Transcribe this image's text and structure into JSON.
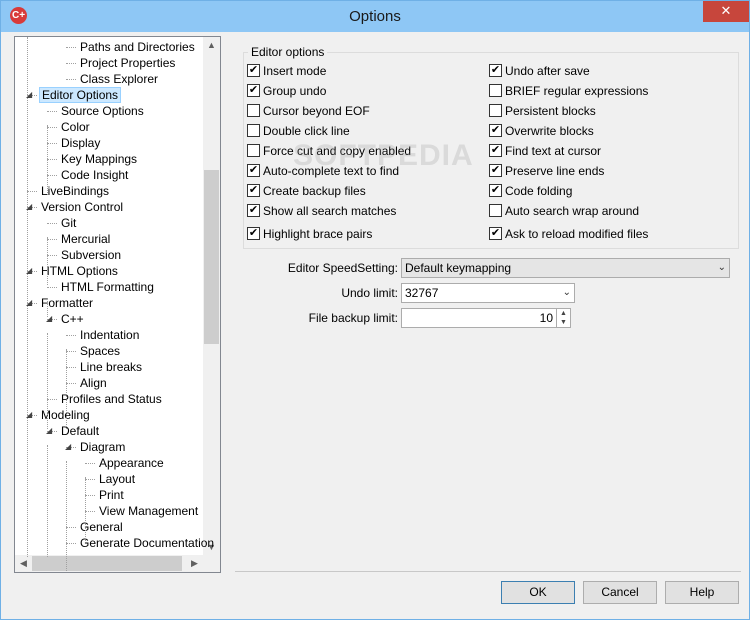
{
  "window": {
    "title": "Options",
    "close_glyph": "✕",
    "app_icon_text": "C+"
  },
  "tree": {
    "items": [
      {
        "label": "Paths and Directories",
        "expander": ""
      },
      {
        "label": "Project Properties",
        "expander": ""
      },
      {
        "label": "Class Explorer",
        "expander": ""
      },
      {
        "label": "Editor Options",
        "expander": "◢"
      },
      {
        "label": "Source Options",
        "expander": ""
      },
      {
        "label": "Color",
        "expander": ""
      },
      {
        "label": "Display",
        "expander": ""
      },
      {
        "label": "Key Mappings",
        "expander": ""
      },
      {
        "label": "Code Insight",
        "expander": ""
      },
      {
        "label": "LiveBindings",
        "expander": ""
      },
      {
        "label": "Version Control",
        "expander": "◢"
      },
      {
        "label": "Git",
        "expander": ""
      },
      {
        "label": "Mercurial",
        "expander": ""
      },
      {
        "label": "Subversion",
        "expander": ""
      },
      {
        "label": "HTML Options",
        "expander": "◢"
      },
      {
        "label": "HTML Formatting",
        "expander": ""
      },
      {
        "label": "Formatter",
        "expander": "◢"
      },
      {
        "label": "C++",
        "expander": "◢"
      },
      {
        "label": "Indentation",
        "expander": ""
      },
      {
        "label": "Spaces",
        "expander": ""
      },
      {
        "label": "Line breaks",
        "expander": ""
      },
      {
        "label": "Align",
        "expander": ""
      },
      {
        "label": "Profiles and Status",
        "expander": ""
      },
      {
        "label": "Modeling",
        "expander": "◢"
      },
      {
        "label": "Default",
        "expander": "◢"
      },
      {
        "label": "Diagram",
        "expander": "◢"
      },
      {
        "label": "Appearance",
        "expander": ""
      },
      {
        "label": "Layout",
        "expander": ""
      },
      {
        "label": "Print",
        "expander": ""
      },
      {
        "label": "View Management",
        "expander": ""
      },
      {
        "label": "General",
        "expander": ""
      },
      {
        "label": "Generate Documentation",
        "expander": ""
      }
    ],
    "selected": "Editor Options",
    "scroll_up": "▲",
    "scroll_down": "▼",
    "scroll_left": "◀",
    "scroll_right": "▶"
  },
  "editor_options": {
    "legend": "Editor options",
    "left": [
      {
        "label": "Insert mode",
        "checked": true
      },
      {
        "label": "Group undo",
        "checked": true
      },
      {
        "label": "Cursor beyond EOF",
        "checked": false
      },
      {
        "label": "Double click line",
        "checked": false
      },
      {
        "label": "Force cut and copy enabled",
        "checked": false
      },
      {
        "label": "Auto-complete text to find",
        "checked": true
      },
      {
        "label": "Create backup files",
        "checked": true
      },
      {
        "label": "Show all search matches",
        "checked": true
      },
      {
        "label": "Highlight brace pairs",
        "checked": true
      }
    ],
    "right": [
      {
        "label": "Undo after save",
        "checked": true
      },
      {
        "label": "BRIEF regular expressions",
        "checked": false
      },
      {
        "label": "Persistent blocks",
        "checked": false
      },
      {
        "label": "Overwrite blocks",
        "checked": true
      },
      {
        "label": "Find text at cursor",
        "checked": true
      },
      {
        "label": "Preserve line ends",
        "checked": true
      },
      {
        "label": "Code folding",
        "checked": true
      },
      {
        "label": "Auto search wrap around",
        "checked": false
      },
      {
        "label": "Ask to reload modified files",
        "checked": true
      }
    ],
    "check_glyph": "✔"
  },
  "fields": {
    "speed_label": "Editor SpeedSetting:",
    "speed_value": "Default keymapping",
    "undo_label": "Undo limit:",
    "undo_value": "32767",
    "backup_label": "File backup limit:",
    "backup_value": "10",
    "dropdown_glyph": "⌄"
  },
  "watermark": "SOFTPEDIA",
  "buttons": {
    "ok": "OK",
    "cancel": "Cancel",
    "help": "Help"
  }
}
